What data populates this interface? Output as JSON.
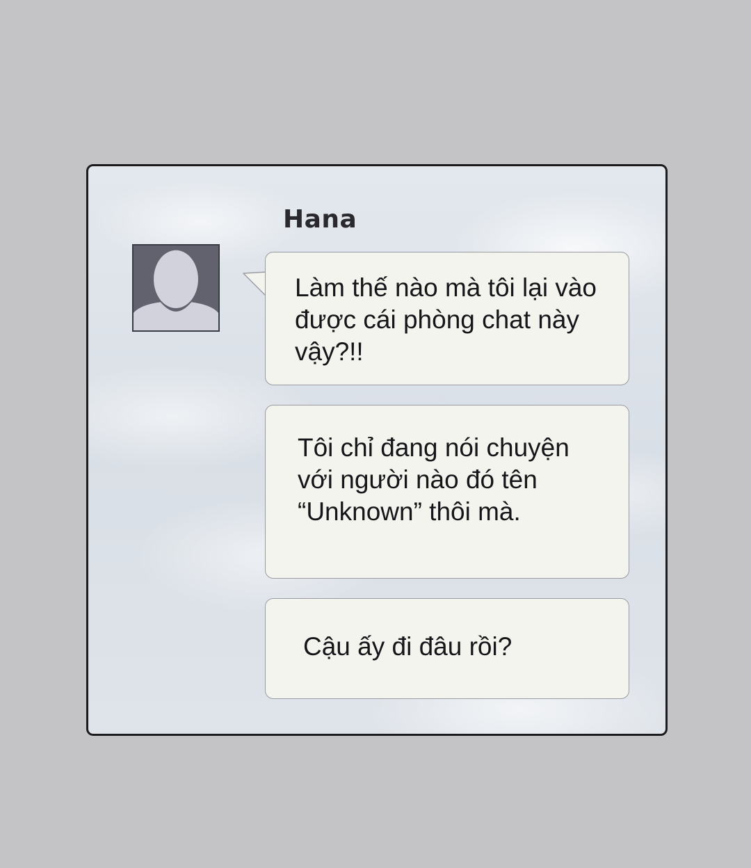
{
  "chat": {
    "sender_name": "Hana",
    "avatar_icon": "default-user-avatar-icon",
    "messages": [
      {
        "text": "Làm thế nào mà tôi lại vào được cái phòng chat này vậy?!!"
      },
      {
        "text": "Tôi chỉ đang nói chuyện với người nào đó tên “Unknown” thôi mà."
      },
      {
        "text": "Cậu ấy đi đâu rồi?"
      }
    ]
  },
  "colors": {
    "page_background": "#c4c4c6",
    "window_border": "#1c1c1e",
    "bubble_fill": "#f4f4ee",
    "bubble_border": "#9a9aa2",
    "avatar_background": "#62626f",
    "avatar_silhouette": "#d2d2dc",
    "text": "#16161a"
  }
}
